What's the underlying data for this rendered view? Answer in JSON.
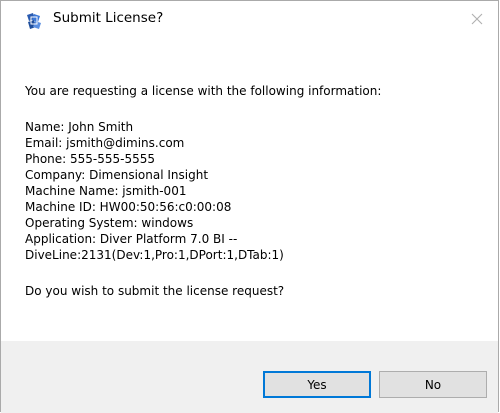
{
  "window": {
    "title": "Submit License?",
    "icon": "dimensional-insight-app-icon",
    "close_icon": "close-icon"
  },
  "message": {
    "intro": "You are requesting a license with the following information:",
    "info": [
      "Name: John Smith",
      "Email: jsmith@dimins.com",
      "Phone: 555-555-5555",
      "Company: Dimensional Insight",
      "Machine Name: jsmith-001",
      "Machine ID: HW00:50:56:c0:00:08",
      "Operating System: windows",
      "Application: Diver Platform 7.0 BI --",
      "DiveLine:2131(Dev:1,Pro:1,DPort:1,DTab:1)"
    ],
    "question": "Do you wish to submit the license request?"
  },
  "buttons": {
    "yes_label": "Yes",
    "no_label": "No"
  },
  "colors": {
    "footer_bg": "#f0f0f0",
    "button_bg": "#e1e1e1",
    "default_button_border": "#0078d7"
  }
}
